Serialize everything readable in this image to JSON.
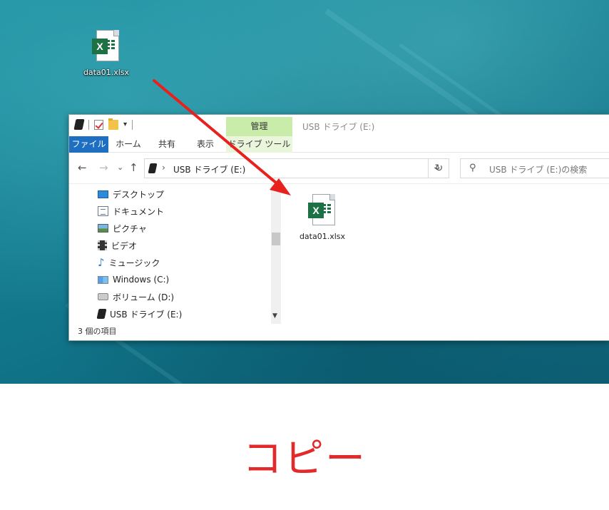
{
  "desktop": {
    "file_label": "data01.xlsx",
    "file_icon": "excel-file-icon"
  },
  "window": {
    "title": "USB ドライブ (E:)",
    "contextual_tab": "管理",
    "ribbon_tabs": [
      "ファイル",
      "ホーム",
      "共有",
      "表示",
      "ドライブ ツール"
    ],
    "address": {
      "chevron": "›",
      "path": "USB ドライブ (E:)",
      "dropdown": "⌄",
      "refresh": "↻"
    },
    "search_placeholder": "USB ドライブ (E:)の検索",
    "nav_buttons": {
      "back": "←",
      "forward": "→",
      "recent": "⌄",
      "up": "↑"
    },
    "nav_items": [
      {
        "label": "デスクトップ",
        "icon": "desktop-icon"
      },
      {
        "label": "ドキュメント",
        "icon": "documents-icon"
      },
      {
        "label": "ピクチャ",
        "icon": "pictures-icon"
      },
      {
        "label": "ビデオ",
        "icon": "videos-icon"
      },
      {
        "label": "ミュージック",
        "icon": "music-icon"
      },
      {
        "label": "Windows (C:)",
        "icon": "windows-drive-icon"
      },
      {
        "label": "ボリューム (D:)",
        "icon": "volume-drive-icon"
      },
      {
        "label": "USB ドライブ (E:)",
        "icon": "usb-drive-icon"
      }
    ],
    "content_file": "data01.xlsx",
    "status": "3 個の項目"
  },
  "annotation": {
    "caption": "コピー",
    "arrow_color": "#e8201e"
  },
  "colors": {
    "file_tab": "#1e6fc2",
    "context_tab": "#c9ecaa",
    "excel_green": "#1e7145"
  }
}
